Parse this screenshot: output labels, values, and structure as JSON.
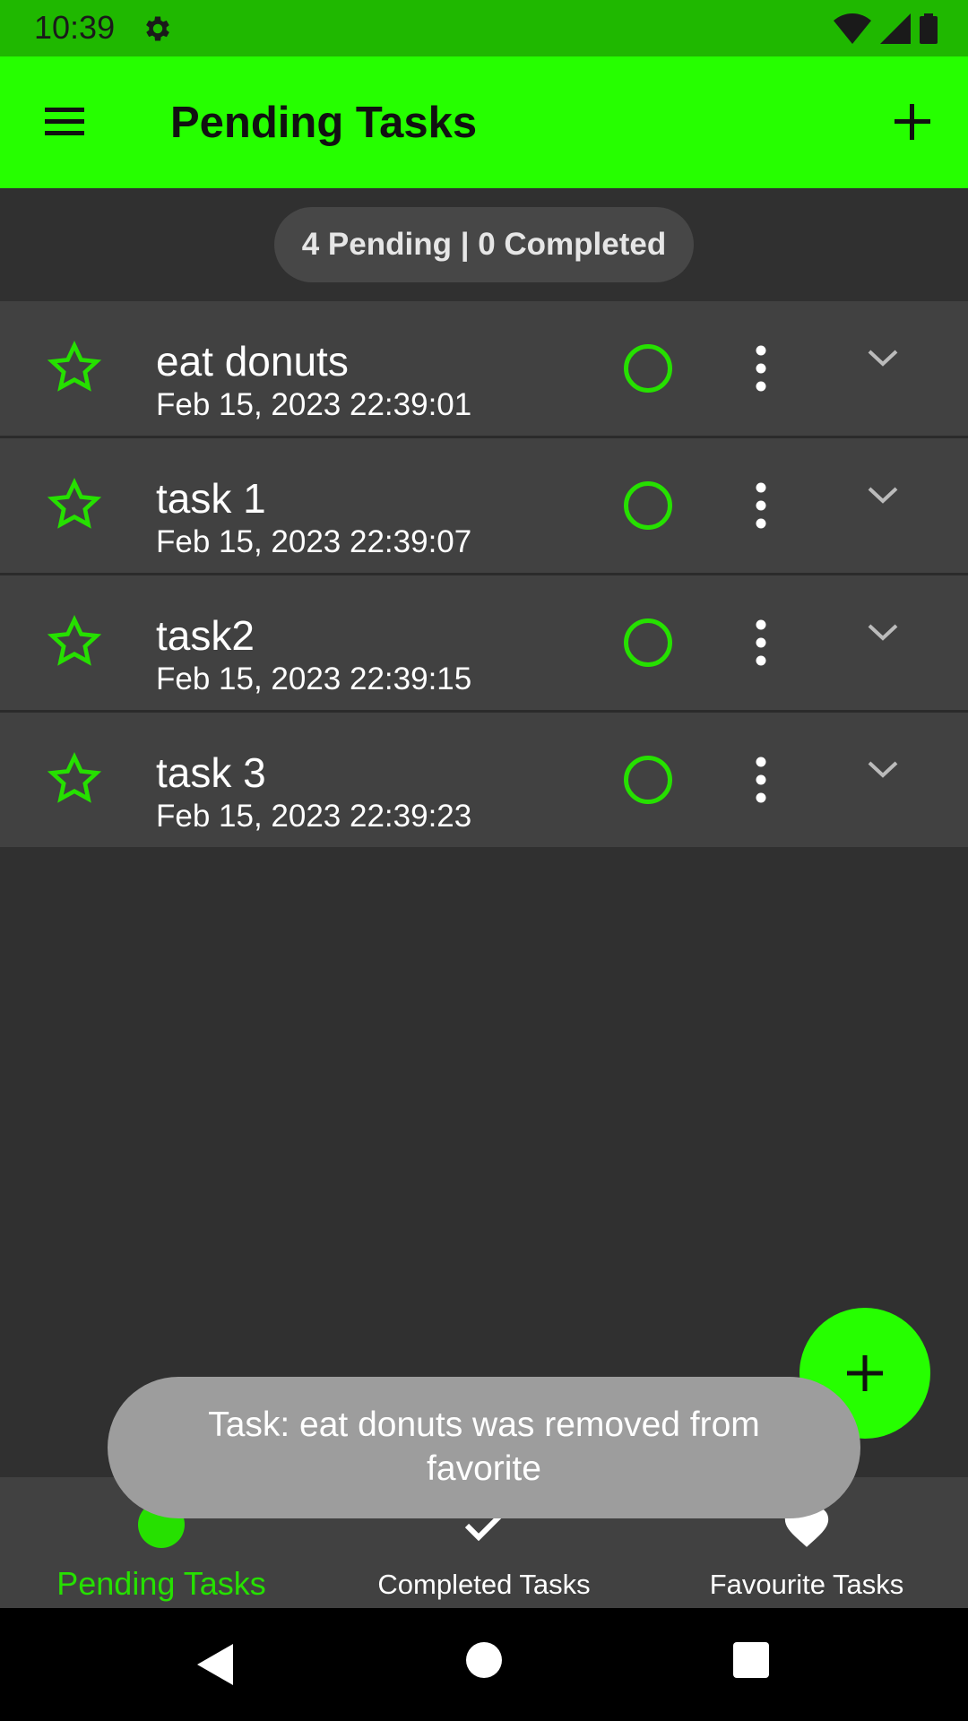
{
  "status_bar": {
    "time": "10:39"
  },
  "app_bar": {
    "title": "Pending Tasks"
  },
  "summary": {
    "text": "4 Pending | 0 Completed"
  },
  "tasks": [
    {
      "title": "eat donuts",
      "date": "Feb 15, 2023 22:39:01"
    },
    {
      "title": "task 1",
      "date": "Feb 15, 2023 22:39:07"
    },
    {
      "title": "task2",
      "date": "Feb 15, 2023 22:39:15"
    },
    {
      "title": "task 3",
      "date": "Feb 15, 2023 22:39:23"
    }
  ],
  "bottom_nav": {
    "items": [
      {
        "label": "Pending Tasks",
        "icon": "pending-icon",
        "active": true
      },
      {
        "label": "Completed Tasks",
        "icon": "check-icon",
        "active": false
      },
      {
        "label": "Favourite Tasks",
        "icon": "heart-icon",
        "active": false
      }
    ]
  },
  "snackbar": {
    "text": "Task: eat donuts was removed from favorite"
  },
  "colors": {
    "accent": "#26ff00",
    "status_bar": "#1fb800",
    "background": "#303030",
    "row": "#414141"
  }
}
